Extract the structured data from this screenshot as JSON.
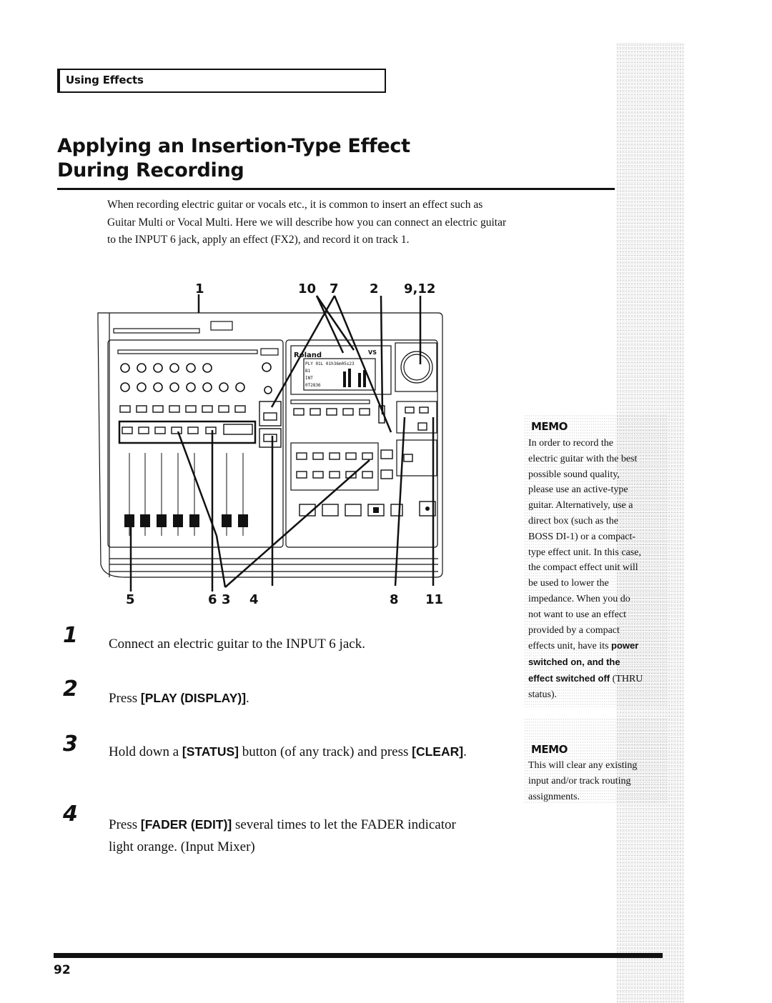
{
  "section_header": "Using Effects",
  "title_line1": "Applying an Insertion-Type Effect",
  "title_line2": "During Recording",
  "intro": "When recording electric guitar or vocals etc., it is common to insert an effect such as Guitar Multi or Vocal Multi. Here we will describe how you can connect an electric guitar to the INPUT 6 jack, apply an effect (FX2), and record it on track 1.",
  "diagram": {
    "top_callouts": [
      "1",
      "10",
      "7",
      "2",
      "9,12"
    ],
    "bottom_callouts": [
      "5",
      "6",
      "3",
      "4",
      "8",
      "11"
    ],
    "brand": "Roland",
    "model": "VS",
    "lcd_line1": "PLY 01L  01h36m05s23",
    "lcd_line2": "B1",
    "lcd_line3": "INT",
    "lcd_line4": "0T2836"
  },
  "steps": [
    {
      "num": "1",
      "parts": [
        {
          "t": "Connect an electric guitar to the INPUT 6 jack."
        }
      ]
    },
    {
      "num": "2",
      "parts": [
        {
          "t": "Press "
        },
        {
          "b": "[PLAY (DISPLAY)]"
        },
        {
          "t": "."
        }
      ]
    },
    {
      "num": "3",
      "parts": [
        {
          "t": "Hold down a "
        },
        {
          "b": "[STATUS]"
        },
        {
          "t": " button (of any track) and press "
        },
        {
          "b": "[CLEAR]"
        },
        {
          "t": "."
        }
      ]
    },
    {
      "num": "4",
      "parts": [
        {
          "t": "Press "
        },
        {
          "b": "[FADER (EDIT)]"
        },
        {
          "t": " several times to let the FADER indicator light orange. (Input Mixer)"
        }
      ]
    }
  ],
  "memo_label": "MEMO",
  "memo1": {
    "lines": [
      "In order to record the",
      "electric guitar with the best",
      "possible sound quality,",
      "please use an active-type",
      "guitar. Alternatively, use a",
      "direct box (such as the",
      "BOSS DI-1) or a compact-",
      "type effect unit. In this case,",
      "the compact effect unit will",
      "be used to lower the",
      "impedance. When you do",
      "not want to use an effect",
      "provided by a compact"
    ],
    "pre_bold": "effects unit, have its ",
    "bold1": "power",
    "bold2": "switched on, and the",
    "bold3": "effect switched off",
    "post": " (THRU",
    "last": "status)."
  },
  "memo2": {
    "lines": [
      "This will clear any existing",
      "input and/or track routing",
      "assignments."
    ]
  },
  "page_number": "92"
}
